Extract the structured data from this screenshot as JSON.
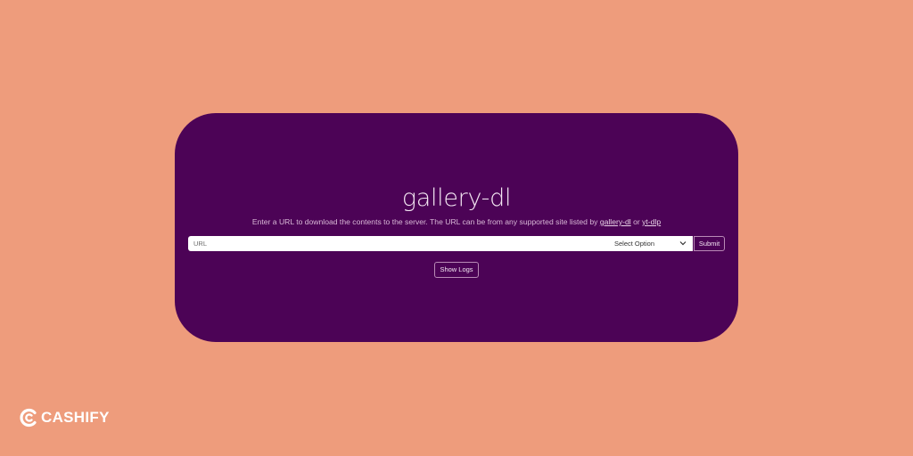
{
  "app": {
    "title": "gallery-dl",
    "description_prefix": "Enter a URL to download the contents to the server. The URL can be from any supported site listed by",
    "link_gallery_dl": "gallery-dl",
    "description_or": "or",
    "link_yt_dlp": "yt-dlp"
  },
  "form": {
    "url_placeholder": "URL",
    "select_value": "Select Option",
    "submit_label": "Submit",
    "show_logs_label": "Show Logs"
  },
  "watermark": {
    "brand": "CASHIFY"
  },
  "colors": {
    "background": "#EE9C7C",
    "card": "#4C0356",
    "text": "#F3E6F2"
  },
  "icons": {
    "select": "chevron-down-icon",
    "watermark": "cashify-logo-icon"
  }
}
